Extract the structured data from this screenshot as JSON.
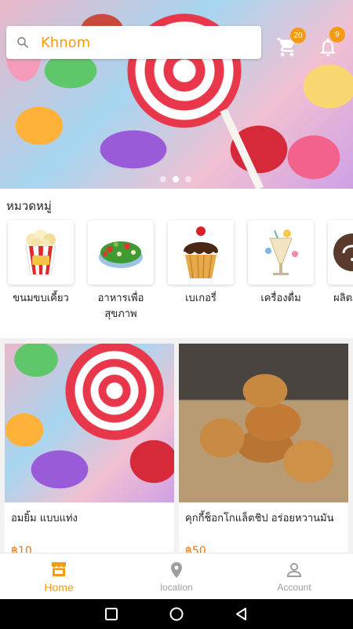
{
  "search": {
    "value": "Khnom",
    "placeholder": "Khnom"
  },
  "header": {
    "cart_count": "20",
    "notification_count": "9"
  },
  "banner": {
    "slides": 3,
    "active_slide": 2
  },
  "categories": {
    "title": "หมวดหมู่",
    "items": [
      {
        "label": "ขนมขบเคี้ยว",
        "icon": "popcorn-icon"
      },
      {
        "label": "อาหารเพื่อสุขภาพ",
        "icon": "salad-icon"
      },
      {
        "label": "เบเกอรี่",
        "icon": "cupcake-icon"
      },
      {
        "label": "เครื่องดื่ม",
        "icon": "drink-icon"
      },
      {
        "label": "ผลิตภัณฑ์ O",
        "icon": "otop-logo-icon"
      }
    ]
  },
  "products": [
    {
      "name": "อมยิ้ม แบบแท่ง",
      "price": "฿10"
    },
    {
      "name": "คุกกี้ช็อกโกแล็ตชิป อร่อยหวานมัน",
      "price": "฿50"
    }
  ],
  "bottom_nav": {
    "home": "Home",
    "location": "location",
    "account": "Account"
  },
  "colors": {
    "accent": "#f39c12",
    "price": "#e8740c"
  }
}
